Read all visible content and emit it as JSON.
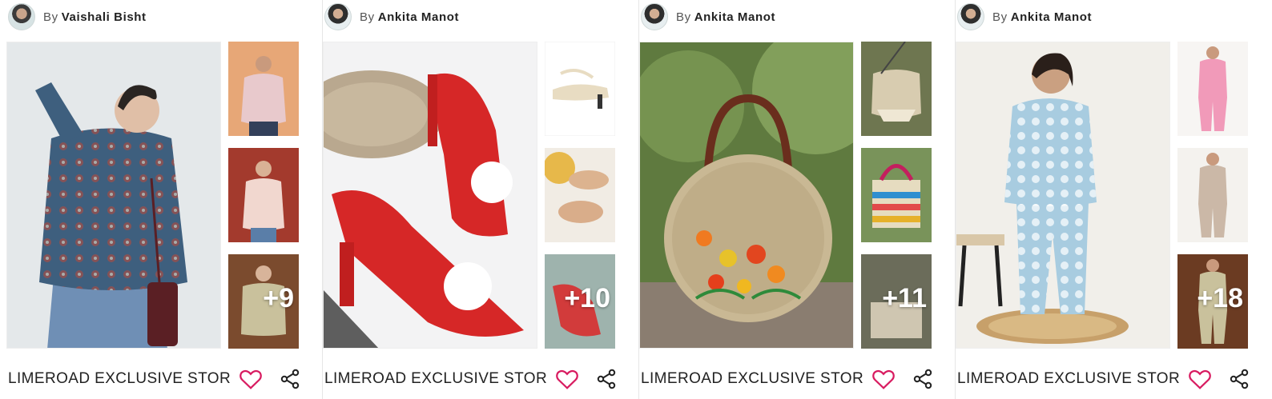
{
  "cards": [
    {
      "author_prefix": "By",
      "author": "Vaishali Bisht",
      "more_count": "+9",
      "store_name": "LIMEROAD EXCLUSIVE STOR"
    },
    {
      "author_prefix": "By",
      "author": "Ankita Manot",
      "more_count": "+10",
      "store_name": "LIMEROAD EXCLUSIVE STOR"
    },
    {
      "author_prefix": "By",
      "author": "Ankita Manot",
      "more_count": "+11",
      "store_name": "LIMEROAD EXCLUSIVE STOR"
    },
    {
      "author_prefix": "By",
      "author": "Ankita Manot",
      "more_count": "+18",
      "store_name": "LIMEROAD EXCLUSIVE STOR"
    }
  ],
  "colors": {
    "heart": "#d81b60",
    "text": "#222222",
    "divider": "#e6e6e6"
  },
  "icons": {
    "like": "heart-outline-icon",
    "share": "share-icon"
  }
}
